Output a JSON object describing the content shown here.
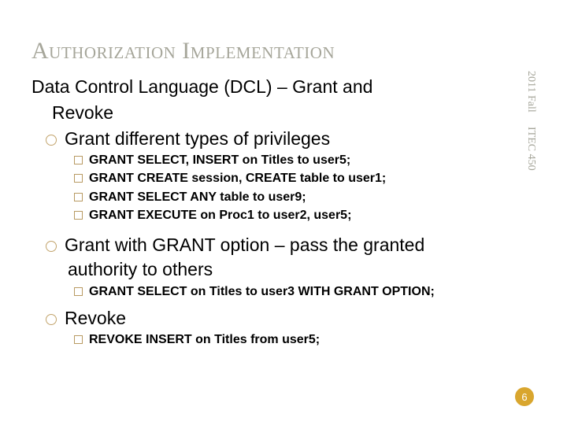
{
  "title": "Authorization Implementation",
  "side": {
    "top": "2011 Fall",
    "bottom": "ITEC 450"
  },
  "body": {
    "p1_line1": "Data Control Language (DCL) – Grant and",
    "p1_line2": "Revoke",
    "b1": "Grant different types of privileges",
    "b1_items": [
      "GRANT SELECT, INSERT on Titles to user5;",
      "GRANT CREATE session, CREATE table to user1;",
      "GRANT SELECT ANY table to user9;",
      "GRANT EXECUTE on Proc1 to user2, user5;"
    ],
    "b2_line1": "Grant with GRANT option – pass the granted",
    "b2_line2": "authority to others",
    "b2_items": [
      "GRANT SELECT on Titles to user3 WITH GRANT OPTION;"
    ],
    "b3": "Revoke",
    "b3_items": [
      "REVOKE INSERT on Titles from user5;"
    ]
  },
  "page": "6"
}
